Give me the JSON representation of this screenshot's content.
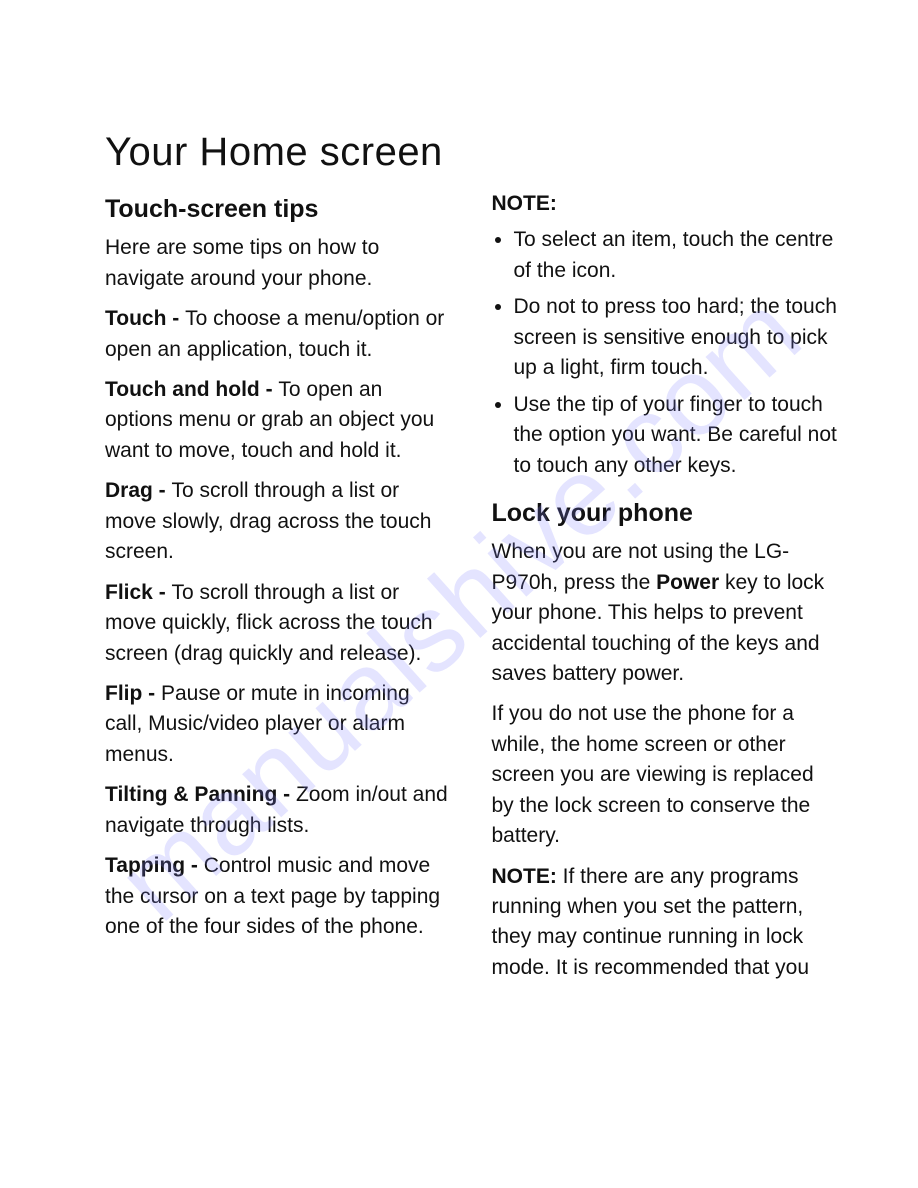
{
  "watermark": "manualshive.com",
  "title": "Your Home screen",
  "left": {
    "heading": "Touch-screen tips",
    "intro": "Here are some tips on how to navigate around your phone.",
    "tips": [
      {
        "term": "Touch - ",
        "desc": "To choose a menu/option or open an application, touch it."
      },
      {
        "term": "Touch and hold - ",
        "desc": "To open an options menu or grab an object you want to move, touch and hold it."
      },
      {
        "term": "Drag - ",
        "desc": "To scroll through a list or move slowly, drag across the touch screen."
      },
      {
        "term": "Flick - ",
        "desc": "To scroll through a list or move quickly, flick across the touch screen (drag quickly and release)."
      },
      {
        "term": "Flip - ",
        "desc": "Pause or mute in incoming call, Music/video player or alarm menus."
      },
      {
        "term": "Tilting & Panning - ",
        "desc": "Zoom in/out and navigate through lists."
      },
      {
        "term": "Tapping - ",
        "desc": "Control music and move the cursor on a text page by tapping one of the four sides of the phone."
      }
    ]
  },
  "right": {
    "note_label": "NOTE:",
    "notes": [
      "To select an item, touch the centre of the icon.",
      "Do not to press too hard; the touch screen is sensitive enough to pick up a light, firm touch.",
      "Use the tip of your finger to touch the option you want. Be careful not to touch any other keys."
    ],
    "lock_heading": "Lock your phone",
    "lock_p1_pre": "When you are not using the LG-P970h, press the ",
    "lock_p1_bold": "Power",
    "lock_p1_post": " key to lock your phone. This helps to prevent accidental touching of the keys and saves battery power.",
    "lock_p2": "If you do not use the phone for a while, the home screen or other screen you are viewing is replaced by the lock screen to conserve the battery.",
    "lock_p3_bold": "NOTE:",
    "lock_p3_rest": " If there are any programs running when you set the pattern, they may continue running in lock mode. It is recommended that you"
  }
}
